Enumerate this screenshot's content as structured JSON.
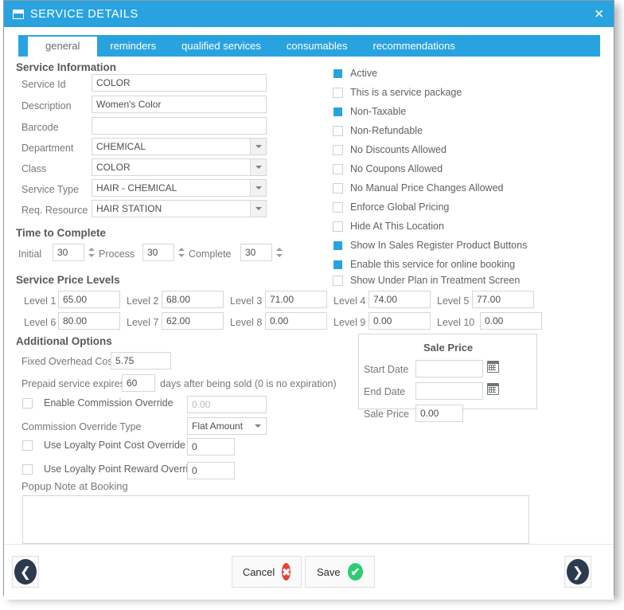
{
  "window": {
    "title": "SERVICE DETAILS",
    "title_icon": "window-form-icon",
    "close_label": "✕",
    "accent_color": "#29a3e0"
  },
  "tabs": [
    {
      "label": "general",
      "active": true
    },
    {
      "label": "reminders",
      "active": false
    },
    {
      "label": "qualified services",
      "active": false
    },
    {
      "label": "consumables",
      "active": false
    },
    {
      "label": "recommendations",
      "active": false
    }
  ],
  "service_information": {
    "heading": "Service Information",
    "fields": [
      {
        "label": "Service Id",
        "value": "COLOR",
        "type": "text"
      },
      {
        "label": "Description",
        "value": "Women's Color",
        "type": "text"
      },
      {
        "label": "Barcode",
        "value": "",
        "type": "text"
      },
      {
        "label": "Department",
        "value": "CHEMICAL",
        "type": "combo"
      },
      {
        "label": "Class",
        "value": "COLOR",
        "type": "combo"
      },
      {
        "label": "Service Type",
        "value": "HAIR - CHEMICAL",
        "type": "combo"
      },
      {
        "label": "Req. Resource",
        "value": "HAIR STATION",
        "type": "combo"
      }
    ]
  },
  "options": {
    "checkboxes": [
      {
        "label": "Active",
        "checked": true
      },
      {
        "label": "This is a service package",
        "checked": false
      },
      {
        "label": "Non-Taxable",
        "checked": true
      },
      {
        "label": "Non-Refundable",
        "checked": false
      },
      {
        "label": "No Discounts Allowed",
        "checked": false
      },
      {
        "label": "No Coupons Allowed",
        "checked": false
      },
      {
        "label": "No Manual Price Changes Allowed",
        "checked": false
      },
      {
        "label": "Enforce Global Pricing",
        "checked": false
      },
      {
        "label": "Hide At This Location",
        "checked": false
      },
      {
        "label": "Show In Sales Register Product Buttons",
        "checked": true
      },
      {
        "label": "Enable this service for online booking",
        "checked": true
      },
      {
        "label": "Show Under Plan in Treatment Screen",
        "checked": false
      }
    ]
  },
  "time_to_complete": {
    "heading": "Time to Complete",
    "items": [
      {
        "label": "Initial",
        "value": "30"
      },
      {
        "label": "Process",
        "value": "30"
      },
      {
        "label": "Complete",
        "value": "30"
      }
    ]
  },
  "price_levels": {
    "heading": "Service Price Levels",
    "items": [
      {
        "label": "Level 1",
        "value": "65.00"
      },
      {
        "label": "Level 2",
        "value": "68.00"
      },
      {
        "label": "Level 3",
        "value": "71.00"
      },
      {
        "label": "Level 4",
        "value": "74.00"
      },
      {
        "label": "Level 5",
        "value": "77.00"
      },
      {
        "label": "Level 6",
        "value": "80.00"
      },
      {
        "label": "Level 7",
        "value": "62.00"
      },
      {
        "label": "Level 8",
        "value": "0.00"
      },
      {
        "label": "Level 9",
        "value": "0.00"
      },
      {
        "label": "Level 10",
        "value": "0.00"
      }
    ]
  },
  "additional_options": {
    "heading": "Additional Options",
    "fixed_overhead_cost_label": "Fixed Overhead Cost",
    "fixed_overhead_cost_value": "5.75",
    "prepaid_label": "Prepaid service expires",
    "prepaid_value": "60",
    "prepaid_suffix": "days after being sold (0 is no expiration)",
    "commission_override_label": "Enable Commission Override",
    "commission_override_checked": false,
    "commission_override_value": "0.00",
    "commission_type_label": "Commission Override Type",
    "commission_type_value": "Flat Amount",
    "loyalty_cost_label": "Use Loyalty Point Cost Override",
    "loyalty_cost_checked": false,
    "loyalty_cost_value": "0",
    "loyalty_reward_label": "Use Loyalty Point Reward Override",
    "loyalty_reward_checked": false,
    "loyalty_reward_value": "0",
    "popup_note_label": "Popup Note at Booking",
    "popup_note_value": ""
  },
  "sale_price": {
    "heading": "Sale Price",
    "start_date_label": "Start Date",
    "start_date_value": "",
    "end_date_label": "End Date",
    "end_date_value": "",
    "sale_price_label": "Sale Price",
    "sale_price_value": "0.00"
  },
  "footer": {
    "prev_label": "❮",
    "next_label": "❯",
    "cancel_label": "Cancel",
    "cancel_icon": "✖",
    "save_label": "Save",
    "save_icon": "✔"
  }
}
